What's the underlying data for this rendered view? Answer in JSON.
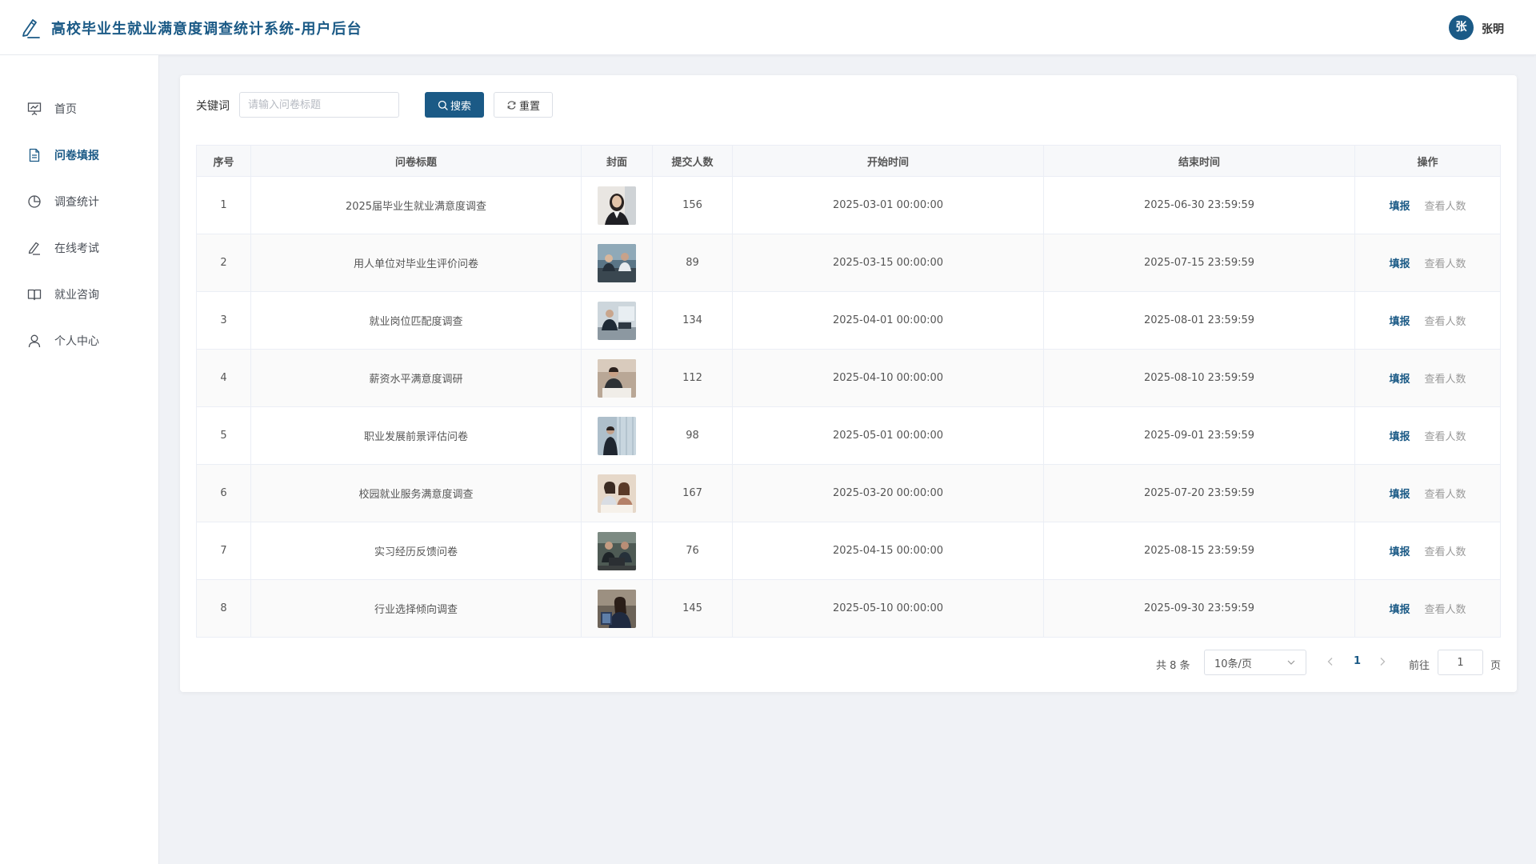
{
  "header": {
    "title": "高校毕业生就业满意度调查统计系统-用户后台",
    "avatar_text": "张",
    "username": "张明"
  },
  "sidebar": {
    "items": [
      {
        "label": "首页",
        "icon": "presentation-chart-icon",
        "active": false
      },
      {
        "label": "问卷填报",
        "icon": "document-icon",
        "active": true
      },
      {
        "label": "调查统计",
        "icon": "pie-chart-icon",
        "active": false
      },
      {
        "label": "在线考试",
        "icon": "pen-icon",
        "active": false
      },
      {
        "label": "就业咨询",
        "icon": "book-icon",
        "active": false
      },
      {
        "label": "个人中心",
        "icon": "user-icon",
        "active": false
      }
    ]
  },
  "search": {
    "keyword_label": "关键词",
    "placeholder": "请输入问卷标题",
    "value": "",
    "search_label": "搜索",
    "reset_label": "重置"
  },
  "table": {
    "headers": [
      "序号",
      "问卷标题",
      "封面",
      "提交人数",
      "开始时间",
      "结束时间",
      "操作"
    ],
    "fill_label": "填报",
    "view_label": "查看人数",
    "rows": [
      {
        "index": "1",
        "title": "2025届毕业生就业满意度调查",
        "submits": "156",
        "start": "2025-03-01 00:00:00",
        "end": "2025-06-30 23:59:59"
      },
      {
        "index": "2",
        "title": "用人单位对毕业生评价问卷",
        "submits": "89",
        "start": "2025-03-15 00:00:00",
        "end": "2025-07-15 23:59:59"
      },
      {
        "index": "3",
        "title": "就业岗位匹配度调查",
        "submits": "134",
        "start": "2025-04-01 00:00:00",
        "end": "2025-08-01 23:59:59"
      },
      {
        "index": "4",
        "title": "薪资水平满意度调研",
        "submits": "112",
        "start": "2025-04-10 00:00:00",
        "end": "2025-08-10 23:59:59"
      },
      {
        "index": "5",
        "title": "职业发展前景评估问卷",
        "submits": "98",
        "start": "2025-05-01 00:00:00",
        "end": "2025-09-01 23:59:59"
      },
      {
        "index": "6",
        "title": "校园就业服务满意度调查",
        "submits": "167",
        "start": "2025-03-20 00:00:00",
        "end": "2025-07-20 23:59:59"
      },
      {
        "index": "7",
        "title": "实习经历反馈问卷",
        "submits": "76",
        "start": "2025-04-15 00:00:00",
        "end": "2025-08-15 23:59:59"
      },
      {
        "index": "8",
        "title": "行业选择倾向调查",
        "submits": "145",
        "start": "2025-05-10 00:00:00",
        "end": "2025-09-30 23:59:59"
      }
    ]
  },
  "pagination": {
    "total": "共 8 条",
    "page_size": "10条/页",
    "current": "1",
    "goto_label": "前往",
    "goto_value": "1",
    "page_suffix": "页"
  },
  "colors": {
    "primary": "#1b5a86",
    "background": "#f0f2f6"
  }
}
